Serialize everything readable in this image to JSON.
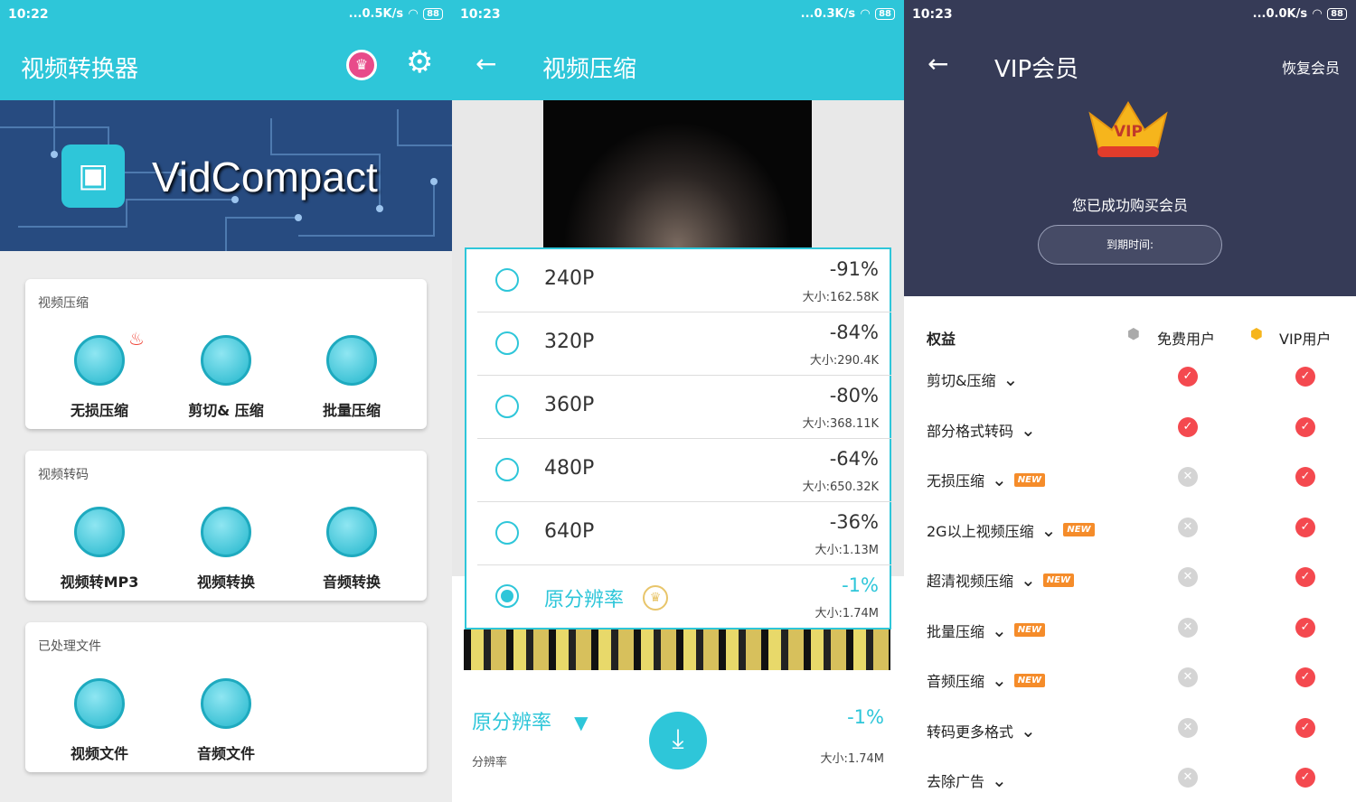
{
  "p1": {
    "status": {
      "time": "10:22",
      "speed": "...0.5K/s",
      "battery": "88"
    },
    "title": "视频转换器",
    "banner_text": "VidCompact",
    "cards": [
      {
        "title": "视频压缩",
        "items": [
          {
            "label": "无损压缩",
            "icon": "film-reel-icon"
          },
          {
            "label": "剪切& 压缩",
            "icon": "zipper-icon"
          },
          {
            "label": "批量压缩",
            "icon": "copy-icon"
          }
        ]
      },
      {
        "title": "视频转码",
        "items": [
          {
            "label": "视频转MP3",
            "icon": "music-note-icon"
          },
          {
            "label": "视频转换",
            "icon": "play-icon"
          },
          {
            "label": "音频转换",
            "icon": "convert-icon"
          }
        ]
      },
      {
        "title": "已处理文件",
        "items": [
          {
            "label": "视频文件",
            "icon": "video-camera-icon"
          },
          {
            "label": "音频文件",
            "icon": "waveform-icon"
          }
        ]
      }
    ]
  },
  "p2": {
    "status": {
      "time": "10:23",
      "speed": "...0.3K/s",
      "battery": "88"
    },
    "title": "视频压缩",
    "options": [
      {
        "res": "240P",
        "pct": "-91%",
        "size": "大小:162.58K"
      },
      {
        "res": "320P",
        "pct": "-84%",
        "size": "大小:290.4K"
      },
      {
        "res": "360P",
        "pct": "-80%",
        "size": "大小:368.11K"
      },
      {
        "res": "480P",
        "pct": "-64%",
        "size": "大小:650.32K"
      },
      {
        "res": "640P",
        "pct": "-36%",
        "size": "大小:1.13M"
      },
      {
        "res": "原分辨率",
        "pct": "-1%",
        "size": "大小:1.74M"
      }
    ],
    "bottom": {
      "selected": "原分辨率",
      "sublabel": "分辨率",
      "pct": "-1%",
      "size": "大小:1.74M"
    },
    "colors": {
      "accent": "#2ec6d9"
    }
  },
  "p3": {
    "status": {
      "time": "10:23",
      "speed": "...0.0K/s",
      "battery": "88"
    },
    "title": "VIP会员",
    "restore": "恢复会员",
    "crown_text": "VIP",
    "success": "您已成功购买会员",
    "expiry": "到期时间:",
    "header": {
      "benefit": "权益",
      "free": "免费用户",
      "vip": "VIP用户"
    },
    "rows": [
      {
        "name": "剪切&压缩",
        "isNew": false,
        "free": true,
        "vip": true
      },
      {
        "name": "部分格式转码",
        "isNew": false,
        "free": true,
        "vip": true
      },
      {
        "name": "无损压缩",
        "isNew": true,
        "free": false,
        "vip": true
      },
      {
        "name": "2G以上视频压缩",
        "isNew": true,
        "free": false,
        "vip": true
      },
      {
        "name": "超清视频压缩",
        "isNew": true,
        "free": false,
        "vip": true
      },
      {
        "name": "批量压缩",
        "isNew": true,
        "free": false,
        "vip": true
      },
      {
        "name": "音频压缩",
        "isNew": true,
        "free": false,
        "vip": true
      },
      {
        "name": "转码更多格式",
        "isNew": false,
        "free": false,
        "vip": true
      },
      {
        "name": "去除广告",
        "isNew": false,
        "free": false,
        "vip": true
      }
    ],
    "new_label": "NEW"
  }
}
